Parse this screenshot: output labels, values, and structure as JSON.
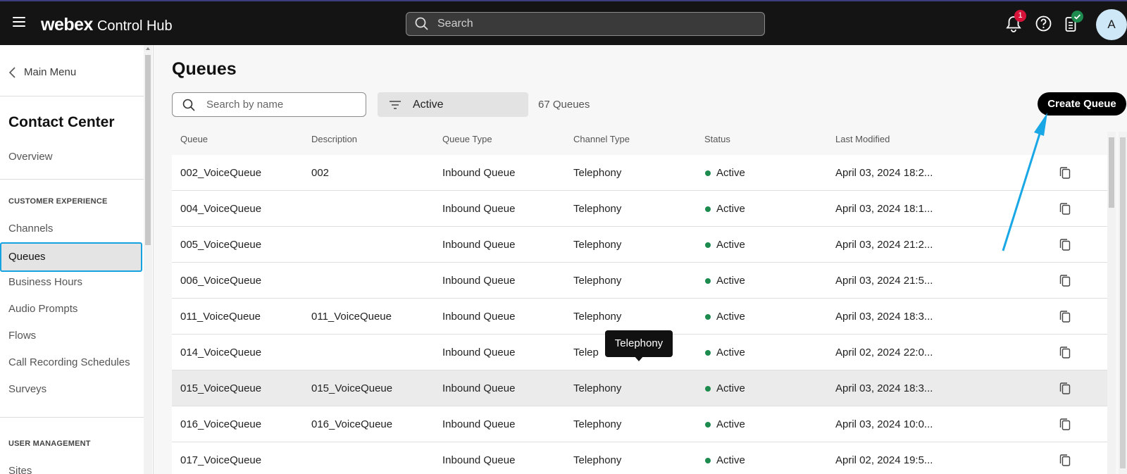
{
  "topbar": {
    "brand_main": "webex",
    "brand_sub": "Control Hub",
    "search_placeholder": "Search",
    "notification_count": "1",
    "avatar_initial": "A"
  },
  "sidebar": {
    "main_menu": "Main Menu",
    "title": "Contact Center",
    "overview": "Overview",
    "section_customer": "CUSTOMER EXPERIENCE",
    "items": [
      "Channels",
      "Queues",
      "Business Hours",
      "Audio Prompts",
      "Flows",
      "Call Recording Schedules",
      "Surveys"
    ],
    "section_user": "USER MANAGEMENT",
    "sites": "Sites"
  },
  "main": {
    "title": "Queues",
    "search_placeholder": "Search by name",
    "filter_value": "Active",
    "queue_count": "67 Queues",
    "create_button": "Create Queue"
  },
  "table": {
    "headers": [
      "Queue",
      "Description",
      "Queue Type",
      "Channel Type",
      "Status",
      "Last Modified"
    ],
    "rows": [
      {
        "queue": "002_VoiceQueue",
        "description": "002",
        "type": "Inbound Queue",
        "channel": "Telephony",
        "status": "Active",
        "modified": "April 03, 2024 18:2..."
      },
      {
        "queue": "004_VoiceQueue",
        "description": "",
        "type": "Inbound Queue",
        "channel": "Telephony",
        "status": "Active",
        "modified": "April 03, 2024 18:1..."
      },
      {
        "queue": "005_VoiceQueue",
        "description": "",
        "type": "Inbound Queue",
        "channel": "Telephony",
        "status": "Active",
        "modified": "April 03, 2024 21:2..."
      },
      {
        "queue": "006_VoiceQueue",
        "description": "",
        "type": "Inbound Queue",
        "channel": "Telephony",
        "status": "Active",
        "modified": "April 03, 2024 21:5..."
      },
      {
        "queue": "011_VoiceQueue",
        "description": "011_VoiceQueue",
        "type": "Inbound Queue",
        "channel": "Telephony",
        "status": "Active",
        "modified": "April 03, 2024 18:3..."
      },
      {
        "queue": "014_VoiceQueue",
        "description": "",
        "type": "Inbound Queue",
        "channel": "Telep",
        "status": "Active",
        "modified": "April 02, 2024 22:0..."
      },
      {
        "queue": "015_VoiceQueue",
        "description": "015_VoiceQueue",
        "type": "Inbound Queue",
        "channel": "Telephony",
        "status": "Active",
        "modified": "April 03, 2024 18:3..."
      },
      {
        "queue": "016_VoiceQueue",
        "description": "016_VoiceQueue",
        "type": "Inbound Queue",
        "channel": "Telephony",
        "status": "Active",
        "modified": "April 03, 2024 10:0..."
      },
      {
        "queue": "017_VoiceQueue",
        "description": "",
        "type": "Inbound Queue",
        "channel": "Telephony",
        "status": "Active",
        "modified": "April 02, 2024 19:5..."
      }
    ]
  },
  "tooltip": "Telephony",
  "colors": {
    "accent_blue": "#14a3e0",
    "status_green": "#1d8a4e",
    "badge_red": "#d6143a"
  }
}
